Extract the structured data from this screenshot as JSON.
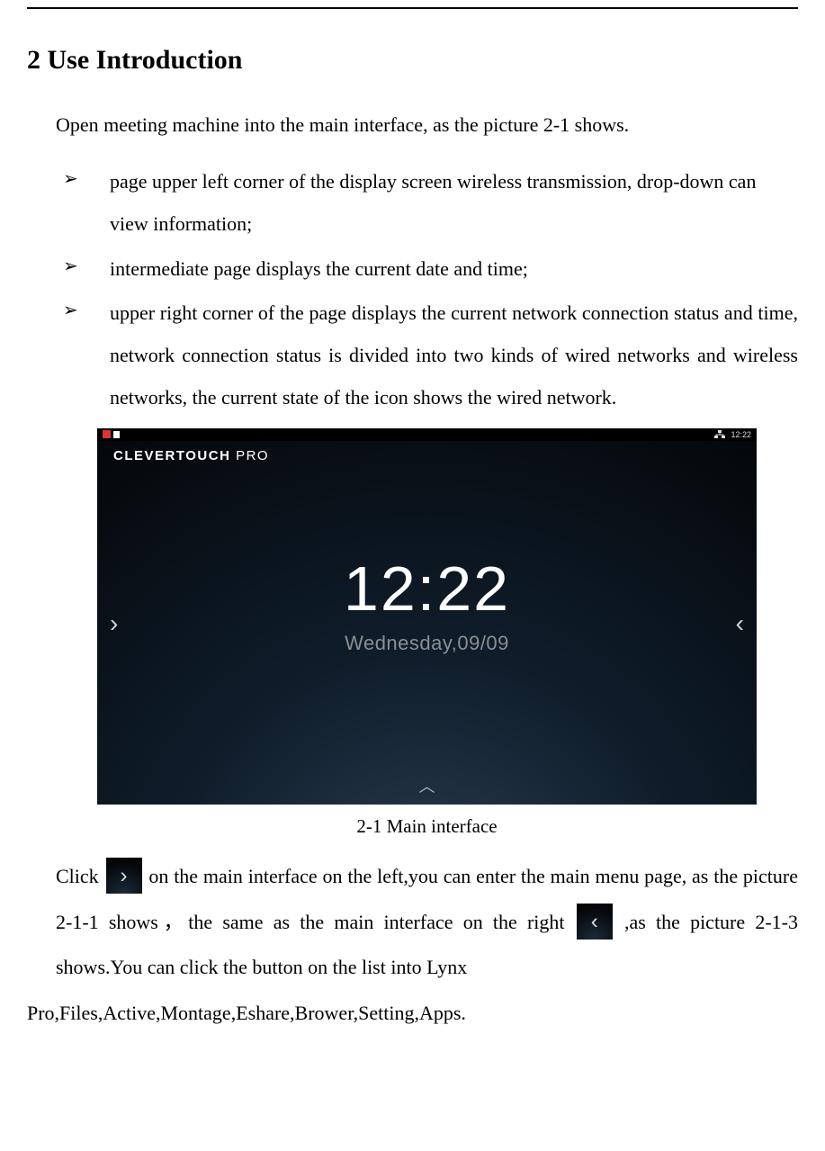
{
  "heading": "2 Use Introduction",
  "intro": "Open meeting machine into the main interface,  as the picture 2-1 shows.",
  "bullets": [
    "page upper left corner of the display screen wireless transmission, drop-down can view information;",
    "intermediate page displays the current date and time;",
    "upper right corner of the page displays the current network connection status and time, network connection status is divided into two kinds of wired networks and wireless networks, the current state of the icon shows the wired network."
  ],
  "screenshot": {
    "logo_a": "CLEVER",
    "logo_b": "TOUCH",
    "logo_c": " PRO",
    "time": "12:22",
    "status_time": "12:22",
    "date": "Wednesday,09/09",
    "nav_left_glyph": "›",
    "nav_right_glyph": "‹",
    "caret_up_glyph": "︿"
  },
  "figure_caption": "2-1 Main interface",
  "para": {
    "p1a": "Click ",
    "p1b": " on the main interface on the left,you can enter the main menu page, as the picture 2-1-1 shows，the same as the main interface on the right ",
    "p1c": ",as the picture 2-1-3 shows.You can click the button on the list into Lynx",
    "p2": "Pro,Files,Active,Montage,Eshare,Brower,Setting,Apps."
  },
  "glyphs": {
    "chevron_right": "›",
    "chevron_left": "‹"
  }
}
